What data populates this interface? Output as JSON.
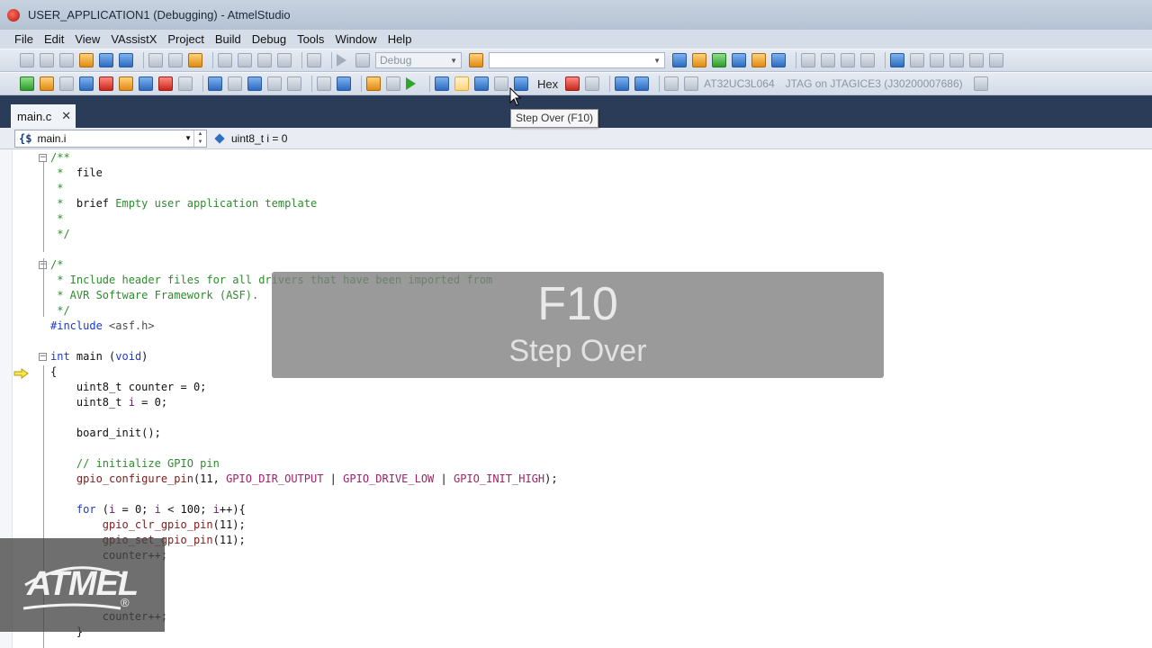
{
  "window": {
    "title": "USER_APPLICATION1 (Debugging) - AtmelStudio"
  },
  "menubar": [
    "File",
    "Edit",
    "View",
    "VAssistX",
    "Project",
    "Build",
    "Debug",
    "Tools",
    "Window",
    "Help"
  ],
  "toolbar": {
    "config": "Debug",
    "hex_label": "Hex",
    "device": "AT32UC3L064",
    "tool": "JTAG on JTAGICE3 (J30200007686)"
  },
  "tooltip": "Step Over (F10)",
  "tab": {
    "name": "main.c",
    "close": "✕"
  },
  "navbar": {
    "scope": "main.i",
    "member": "uint8_t i = 0"
  },
  "code": [
    {
      "t": [
        [
          "cmt",
          "/**"
        ]
      ]
    },
    {
      "t": [
        [
          "cmt",
          " *  "
        ],
        [
          "plain",
          "file"
        ]
      ]
    },
    {
      "t": [
        [
          "cmt",
          " *"
        ]
      ]
    },
    {
      "t": [
        [
          "cmt",
          " *  "
        ],
        [
          "plain",
          "brief"
        ],
        [
          "cmt",
          " Empty user application template"
        ]
      ]
    },
    {
      "t": [
        [
          "cmt",
          " *"
        ]
      ]
    },
    {
      "t": [
        [
          "cmt",
          " */"
        ]
      ]
    },
    {
      "t": [
        [
          "plain",
          ""
        ]
      ]
    },
    {
      "t": [
        [
          "cmt",
          "/*"
        ]
      ]
    },
    {
      "t": [
        [
          "cmt",
          " * Include header files for all drivers that have been imported from"
        ]
      ]
    },
    {
      "t": [
        [
          "cmt",
          " * AVR Software Framework (ASF)."
        ]
      ]
    },
    {
      "t": [
        [
          "cmt",
          " */"
        ]
      ]
    },
    {
      "t": [
        [
          "kw",
          "#include"
        ],
        [
          "pp",
          " <asf.h>"
        ]
      ]
    },
    {
      "t": [
        [
          "plain",
          ""
        ]
      ]
    },
    {
      "t": [
        [
          "kw",
          "int"
        ],
        [
          "plain",
          " main ("
        ],
        [
          "kw",
          "void"
        ],
        [
          "plain",
          ")"
        ]
      ]
    },
    {
      "t": [
        [
          "plain",
          "{"
        ]
      ]
    },
    {
      "t": [
        [
          "plain",
          "    uint8_t counter = 0;"
        ]
      ]
    },
    {
      "t": [
        [
          "plain",
          "    uint8_t "
        ],
        [
          "var",
          "i"
        ],
        [
          "plain",
          " = 0;"
        ]
      ]
    },
    {
      "t": [
        [
          "plain",
          ""
        ]
      ]
    },
    {
      "t": [
        [
          "plain",
          "    board_init();"
        ]
      ]
    },
    {
      "t": [
        [
          "plain",
          ""
        ]
      ]
    },
    {
      "t": [
        [
          "cmt",
          "    // initialize GPIO pin"
        ]
      ]
    },
    {
      "t": [
        [
          "fn",
          "    gpio_configure_pin"
        ],
        [
          "plain",
          "(11, "
        ],
        [
          "mac",
          "GPIO_DIR_OUTPUT"
        ],
        [
          "plain",
          " | "
        ],
        [
          "mac",
          "GPIO_DRIVE_LOW"
        ],
        [
          "plain",
          " | "
        ],
        [
          "mac",
          "GPIO_INIT_HIGH"
        ],
        [
          "plain",
          ");"
        ]
      ]
    },
    {
      "t": [
        [
          "plain",
          ""
        ]
      ]
    },
    {
      "t": [
        [
          "kw",
          "    for"
        ],
        [
          "plain",
          " ("
        ],
        [
          "var",
          "i"
        ],
        [
          "plain",
          " = 0; "
        ],
        [
          "var",
          "i"
        ],
        [
          "plain",
          " < 100; "
        ],
        [
          "var",
          "i"
        ],
        [
          "plain",
          "++){"
        ]
      ]
    },
    {
      "t": [
        [
          "fn",
          "        gpio_clr_gpio_pin"
        ],
        [
          "plain",
          "(11);"
        ]
      ]
    },
    {
      "t": [
        [
          "fn",
          "        gpio_set_gpio_pin"
        ],
        [
          "plain",
          "(11);"
        ]
      ]
    },
    {
      "t": [
        [
          "plain",
          "        counter++;"
        ]
      ]
    },
    {
      "t": [
        [
          "plain",
          ""
        ]
      ]
    },
    {
      "t": [
        [
          "plain",
          ""
        ]
      ]
    },
    {
      "t": [
        [
          "plain",
          ""
        ]
      ]
    },
    {
      "t": [
        [
          "plain",
          "        counter++;"
        ]
      ]
    },
    {
      "t": [
        [
          "plain",
          "    }"
        ]
      ]
    }
  ],
  "overlay": {
    "key": "F10",
    "action": "Step Over"
  },
  "logo": {
    "brand": "ATMEL",
    "reg": "®"
  }
}
